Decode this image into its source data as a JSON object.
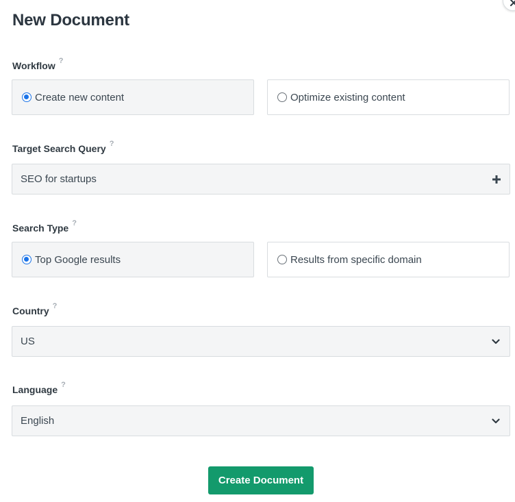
{
  "dialog": {
    "title": "New Document",
    "help_glyph": "?"
  },
  "workflow": {
    "label": "Workflow",
    "options": [
      {
        "label": "Create new content",
        "selected": true
      },
      {
        "label": "Optimize existing content",
        "selected": false
      }
    ]
  },
  "target_query": {
    "label": "Target Search Query",
    "value": "SEO for startups",
    "add_icon": "plus-icon"
  },
  "search_type": {
    "label": "Search Type",
    "options": [
      {
        "label": "Top Google results",
        "selected": true
      },
      {
        "label": "Results from specific domain",
        "selected": false
      }
    ]
  },
  "country": {
    "label": "Country",
    "selected": "US"
  },
  "language": {
    "label": "Language",
    "selected": "English"
  },
  "actions": {
    "create_label": "Create Document"
  },
  "colors": {
    "primary": "#139a6c",
    "radio_checked": "#1a73e8",
    "field_bg": "#f4f5f6"
  }
}
